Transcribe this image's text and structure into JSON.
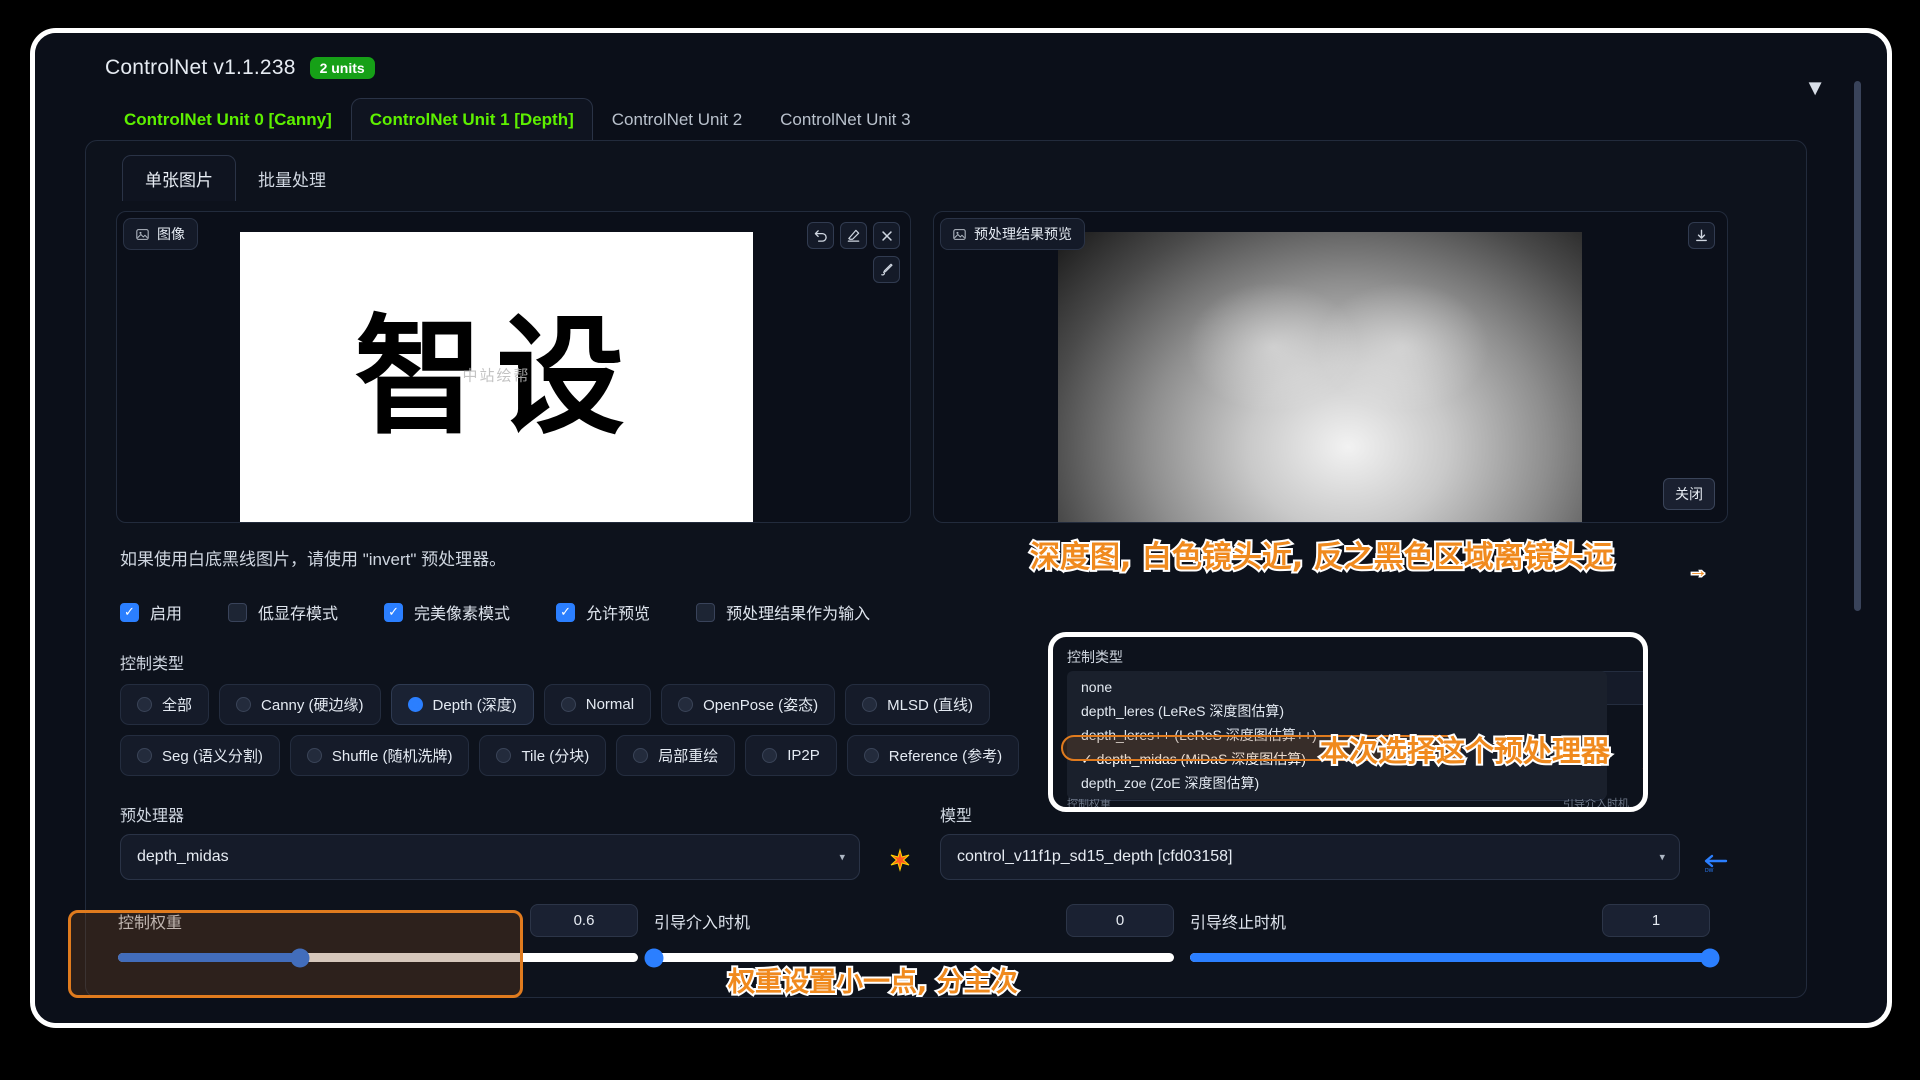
{
  "header": {
    "title": "ControlNet v1.1.238",
    "badge": "2 units",
    "collapse_icon": "▼"
  },
  "unit_tabs": [
    {
      "label": "ControlNet Unit 0 [Canny]",
      "state": "green"
    },
    {
      "label": "ControlNet Unit 1 [Depth]",
      "state": "active-green"
    },
    {
      "label": "ControlNet Unit 2",
      "state": "plain"
    },
    {
      "label": "ControlNet Unit 3",
      "state": "plain"
    }
  ],
  "sub_tabs": [
    {
      "label": "单张图片",
      "active": true
    },
    {
      "label": "批量处理",
      "active": false
    }
  ],
  "image_panel": {
    "tag": "图像",
    "canvas_text": "智设",
    "watermark": "中站绘帮",
    "tools": [
      {
        "name": "undo-icon",
        "glyph": "↺"
      },
      {
        "name": "erase-icon",
        "glyph": "✐"
      },
      {
        "name": "close-icon",
        "glyph": "✕"
      },
      {
        "name": "edit-icon",
        "glyph": "✎"
      }
    ]
  },
  "preview_panel": {
    "tag": "预处理结果预览",
    "download_icon": "⤓",
    "close_label": "关闭"
  },
  "hint": "如果使用白底黑线图片，请使用 \"invert\" 预处理器。",
  "checkboxes": [
    {
      "label": "启用",
      "checked": true
    },
    {
      "label": "低显存模式",
      "checked": false
    },
    {
      "label": "完美像素模式",
      "checked": true
    },
    {
      "label": "允许预览",
      "checked": true
    },
    {
      "label": "预处理结果作为输入",
      "checked": false
    }
  ],
  "control_type": {
    "label": "控制类型",
    "row1": [
      {
        "label": "全部",
        "selected": false
      },
      {
        "label": "Canny (硬边缘)",
        "selected": false
      },
      {
        "label": "Depth (深度)",
        "selected": true
      },
      {
        "label": "Normal",
        "selected": false
      },
      {
        "label": "OpenPose (姿态)",
        "selected": false
      },
      {
        "label": "MLSD (直线)",
        "selected": false
      }
    ],
    "row2": [
      {
        "label": "Seg (语义分割)",
        "selected": false
      },
      {
        "label": "Shuffle (随机洗牌)",
        "selected": false
      },
      {
        "label": "Tile (分块)",
        "selected": false
      },
      {
        "label": "局部重绘",
        "selected": false
      },
      {
        "label": "IP2P",
        "selected": false
      },
      {
        "label": "Reference (参考)",
        "selected": false
      }
    ]
  },
  "preprocessor": {
    "label": "预处理器",
    "value": "depth_midas",
    "caret": "▾"
  },
  "model": {
    "label": "模型",
    "value": "control_v11f1p_sd15_depth [cfd03158]",
    "caret": "▾"
  },
  "refresh_icon": "✳",
  "swap_icon": "⇐",
  "sliders": [
    {
      "label": "控制权重",
      "value": "0.6",
      "pct": 35
    },
    {
      "label": "引导介入时机",
      "value": "0",
      "pct": 0
    },
    {
      "label": "引导终止时机",
      "value": "1",
      "pct": 100
    }
  ],
  "dropdown_overlay": {
    "title": "控制类型",
    "items": [
      {
        "label": "none",
        "checked": false
      },
      {
        "label": "depth_leres (LeReS 深度图估算)",
        "checked": false
      },
      {
        "label": "depth_leres++ (LeReS 深度图估算++)",
        "checked": false
      },
      {
        "label": "✓ depth_midas (MiDaS 深度图估算)",
        "checked": true
      },
      {
        "label": "depth_zoe (ZoE 深度图估算)",
        "checked": false
      }
    ],
    "input_caret": "▾",
    "footer_left": "控制权重",
    "footer_right": "引导介入时机"
  },
  "annotations": {
    "depth_note": "深度图, 白色镜头近, 反之黑色区域离镜头远",
    "preproc_note": "本次选择这个预处理器",
    "weight_note": "权重设置小一点, 分主次",
    "arrow": "→"
  },
  "colors": {
    "accent_blue": "#2b7fff",
    "annotation_orange": "#f08a1e",
    "tab_green": "#5ef000",
    "badge_green": "#16a017",
    "bg": "#0b0f19"
  }
}
